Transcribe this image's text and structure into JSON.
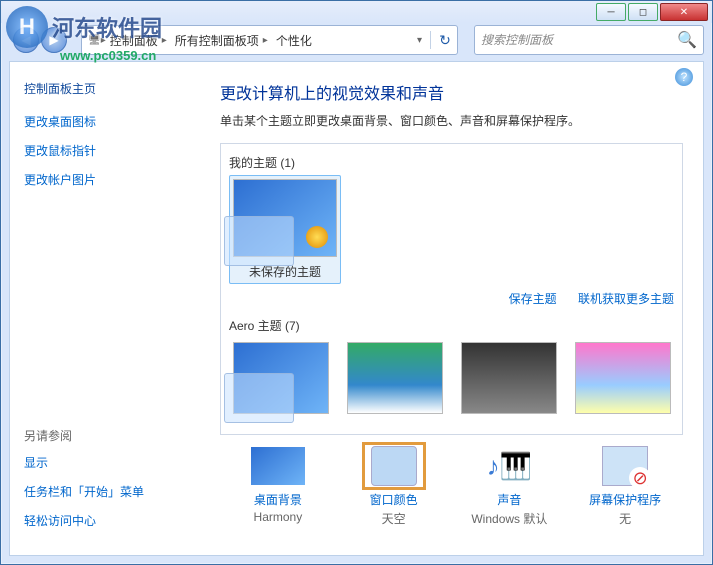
{
  "watermark": {
    "text": "河东软件园",
    "sub": "www.pc0359.cn"
  },
  "breadcrumb": {
    "items": [
      "控制面板",
      "所有控制面板项",
      "个性化"
    ]
  },
  "search": {
    "placeholder": "搜索控制面板"
  },
  "sidebar": {
    "home": "控制面板主页",
    "links": [
      "更改桌面图标",
      "更改鼠标指针",
      "更改帐户图片"
    ],
    "see_also_header": "另请参阅",
    "see_also": [
      "显示",
      "任务栏和「开始」菜单",
      "轻松访问中心"
    ]
  },
  "main": {
    "title": "更改计算机上的视觉效果和声音",
    "subtitle": "单击某个主题立即更改桌面背景、窗口颜色、声音和屏幕保护程序。"
  },
  "themes": {
    "my_header": "我的主题 (1)",
    "my_items": [
      {
        "name": "未保存的主题"
      }
    ],
    "links": {
      "save": "保存主题",
      "more": "联机获取更多主题"
    },
    "aero_header": "Aero 主题 (7)",
    "aero_items": [
      {
        "name": ""
      },
      {
        "name": ""
      },
      {
        "name": ""
      },
      {
        "name": ""
      }
    ]
  },
  "settings": {
    "bg": {
      "label": "桌面背景",
      "value": "Harmony"
    },
    "color": {
      "label": "窗口颜色",
      "value": "天空"
    },
    "sound": {
      "label": "声音",
      "value": "Windows 默认"
    },
    "scr": {
      "label": "屏幕保护程序",
      "value": "无"
    }
  }
}
